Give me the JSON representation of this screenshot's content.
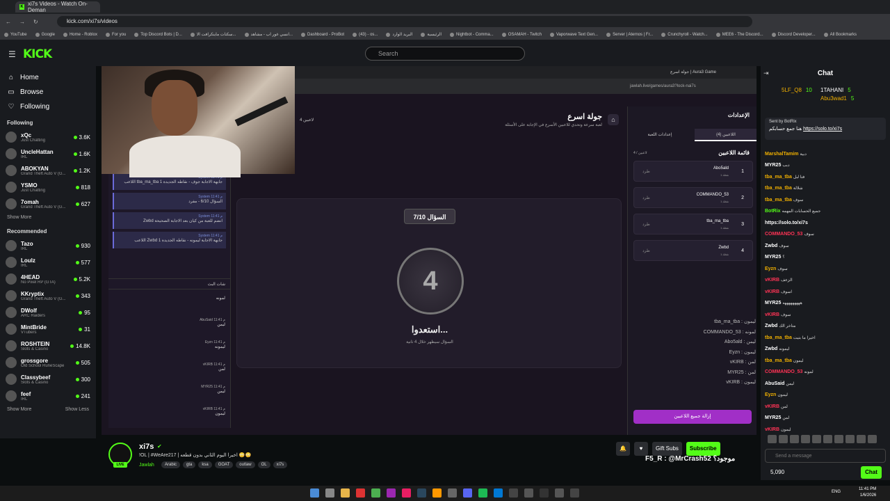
{
  "browser": {
    "tab_title": "xi7s Videos - Watch On-Deman",
    "url": "kick.com/xi7s/videos",
    "bookmarks": [
      "YouTube",
      "Google",
      "Home - Roblox",
      "For you",
      "Top Discord Bots | D...",
      "سكنات ماينكرافت الا...",
      "انسي غور اب - مشاهد...",
      "Dashboard - ProBot",
      "(43) - os...",
      "البريد الوارد",
      "الرئيسية",
      "Nightbot - Comma...",
      "OSAMAH - Twitch",
      "Vaporwave Text Gen...",
      "Server | Aternos | Fr...",
      "Crunchyroll - Watch...",
      "MEE6 - The Discord...",
      "Discord Developer...",
      "All Bookmarks"
    ]
  },
  "nav": {
    "logo": "KICK",
    "search_placeholder": "Search"
  },
  "sidebar": {
    "main": [
      {
        "label": "Home",
        "icon": "home-icon"
      },
      {
        "label": "Browse",
        "icon": "browse-icon"
      },
      {
        "label": "Following",
        "icon": "heart-icon"
      }
    ],
    "following_title": "Following",
    "following": [
      {
        "name": "xQc",
        "cat": "Just Chatting",
        "viewers": "3.6K"
      },
      {
        "name": "UncleHattan",
        "cat": "IRL",
        "viewers": "1.6K"
      },
      {
        "name": "ABOKYAN",
        "cat": "Grand Theft Auto V (G...",
        "viewers": "1.2K"
      },
      {
        "name": "YSMO",
        "cat": "Just Chatting",
        "viewers": "818"
      },
      {
        "name": "7omah",
        "cat": "Grand Theft Auto V (G...",
        "viewers": "627"
      }
    ],
    "show_more": "Show More",
    "recommended_title": "Recommended",
    "recommended": [
      {
        "name": "Tazo",
        "cat": "IRL",
        "viewers": "930"
      },
      {
        "name": "Loulz",
        "cat": "IRL",
        "viewers": "577"
      },
      {
        "name": "4HEAD",
        "cat": "No Pixel RP (GTA)",
        "viewers": "5.2K"
      },
      {
        "name": "KKryptix",
        "cat": "Grand Theft Auto V (G...",
        "viewers": "343"
      },
      {
        "name": "DWolf",
        "cat": "ARC Raiders",
        "viewers": "95"
      },
      {
        "name": "MintBride",
        "cat": "VTubers",
        "viewers": "31"
      },
      {
        "name": "ROSHTEIN",
        "cat": "Slots & Casino",
        "viewers": "14.8K"
      },
      {
        "name": "grossgore",
        "cat": "Old School RuneScape",
        "viewers": "505"
      },
      {
        "name": "Classybeef",
        "cat": "Slots & Casino",
        "viewers": "300"
      },
      {
        "name": "feef",
        "cat": "IRL",
        "viewers": "241"
      }
    ],
    "show_more2": "Show More",
    "show_less": "Show Less"
  },
  "game": {
    "inner_tab": "جولة اسرع | Aura3 Game",
    "inner_url": "jawlah.live/games/aura3?lock-nai7s",
    "title": "جولة اسرع",
    "subtitle": "لعبة سرعة وتحدي للاعبين الأسرع في الإجابة على الأسئلة",
    "player_count": "4 لاعبين",
    "system_msgs": [
      {
        "meta": "System 11:41 م",
        "text": "اللاعب tba_ma_tba جابهة الاجابة جوف - نقاطه الجديدة 1"
      },
      {
        "meta": "System 11:41 م",
        "text": "السؤال 6/10 - مفرد"
      },
      {
        "meta": "System 11:41 م",
        "text": "Zwbd انضم للعبة من كيان بعد الاجابة الصحيحة"
      },
      {
        "meta": "System 11:41 م",
        "text": "اللاعب Zwbd جابهة الاجابة ليمونه - نقاطه الجديدة 1"
      }
    ],
    "chat_header": "شات البث",
    "chat_msgs": [
      {
        "who": "",
        "text": "لمونه"
      },
      {
        "who": "AbuSaid 11:41 م",
        "text": "ليمن"
      },
      {
        "who": "Eyzn 11:41 م",
        "text": "ليمونه"
      },
      {
        "who": "vKIRB 11:41 م",
        "text": "لمن"
      },
      {
        "who": "MYR25 11:41 م",
        "text": "ليمن"
      },
      {
        "who": "vKIRB 11:41 م",
        "text": "ليمون"
      }
    ],
    "question_label": "السؤال 7/10",
    "countdown": "4",
    "get_ready": "استعدوا...",
    "get_ready_sub": "السؤال سيظهر خلال 4 ثانية",
    "settings_title": "الإعدادات",
    "tab_players": "اللاعبين (4)",
    "tab_settings": "إعدادات اللعبة",
    "players_title": "قائمة اللاعبين",
    "players_sub": "4 / لاعبين",
    "players": [
      {
        "name": "Abo5ald",
        "rank": "1",
        "sub": "نقطة 1",
        "kick": "طرد"
      },
      {
        "name": "COMMANDO_53",
        "rank": "2",
        "sub": "نقطة 1",
        "kick": "طرد"
      },
      {
        "name": "tba_ma_tba",
        "rank": "3",
        "sub": "نقطة 1",
        "kick": "طرد"
      },
      {
        "name": "Zwbd",
        "rank": "4",
        "sub": "نقطة 1",
        "kick": "طرد"
      }
    ],
    "votes": [
      "tba_ma_tba : ليمون",
      "COMMANDO_53 : لمونه",
      "Abo5ald : ليمن",
      "Eyzn : ليمون",
      "vKIRB : لمن",
      "MYR25 : لمن",
      "vKIRB : ليمون"
    ],
    "remove_all": "إزالة جميع اللاعبين"
  },
  "chat": {
    "title": "Chat",
    "gifters": [
      {
        "name": "5LF_Q8",
        "count": "10"
      },
      {
        "name": "1TAHANI",
        "count": "5"
      },
      {
        "name": "Abu3wad1",
        "count": "5"
      }
    ],
    "pinned_by": "Sent by BotRix",
    "pinned_msg": "هنا جمع حسابكم",
    "pinned_link": "https://solo.to/xi7s",
    "messages": [
      {
        "u": "MarshalTamim",
        "c": "#f0b000",
        "t": "دبية"
      },
      {
        "u": "MYR25",
        "c": "#ffffff",
        "t": "دبب"
      },
      {
        "u": "tba_ma_tba",
        "c": "#f0b000",
        "t": "فتا لبل"
      },
      {
        "u": "tba_ma_tba",
        "c": "#f0b000",
        "t": "شلالة"
      },
      {
        "u": "tba_ma_tba",
        "c": "#f0b000",
        "t": "سوف"
      },
      {
        "u": "BotRix",
        "c": "#53fc18",
        "t": "جميع الحسابات المهمه"
      },
      {
        "u": "https://solo.to/xi7s",
        "c": "#ffffff",
        "t": ""
      },
      {
        "u": "COMMANDO_53",
        "c": "#ff3355",
        "t": "سوف"
      },
      {
        "u": "Zwbd",
        "c": "#ffffff",
        "t": "سوف"
      },
      {
        "u": "MYR25",
        "c": "#ffffff",
        "t": "؟"
      },
      {
        "u": "Eyzn",
        "c": "#f0b000",
        "t": "سوف"
      },
      {
        "u": "vKIRB",
        "c": "#ff3355",
        "t": "الزعف"
      },
      {
        "u": "vKIRB",
        "c": "#ff3355",
        "t": "اسوف"
      },
      {
        "u": "MYR25",
        "c": "#ffffff",
        "t": "هههههههههه"
      },
      {
        "u": "vKIRB",
        "c": "#ff3355",
        "t": "سوف"
      },
      {
        "u": "Zwbd",
        "c": "#ffffff",
        "t": "متاخر الك"
      },
      {
        "u": "tba_ma_tba",
        "c": "#f0b000",
        "t": "اخيرا ما بتيت"
      },
      {
        "u": "Zwbd",
        "c": "#ffffff",
        "t": "ليمونه"
      },
      {
        "u": "tba_ma_tba",
        "c": "#f0b000",
        "t": "ليمون"
      },
      {
        "u": "COMMANDO_53",
        "c": "#ff3355",
        "t": "لمونه"
      },
      {
        "u": "AbuSaid",
        "c": "#ffffff",
        "t": "ليمن"
      },
      {
        "u": "Eyzn",
        "c": "#f0b000",
        "t": "ليمون"
      },
      {
        "u": "vKIRB",
        "c": "#ff3355",
        "t": "لمن"
      },
      {
        "u": "MYR25",
        "c": "#ffffff",
        "t": "لمن"
      },
      {
        "u": "vKIRB",
        "c": "#ff3355",
        "t": "ليمون"
      }
    ],
    "input_placeholder": "Send a message",
    "points": "5,090",
    "send_label": "Chat"
  },
  "stream": {
    "name": "xi7s",
    "live": "LIVE",
    "title": "!OL | #WeAre217 | اخيرا اليوم الثاني بدون قطعه 😳😳",
    "category": "Jawlah",
    "tags": [
      "Arabic",
      "gta",
      "ksa",
      "GOAT",
      "outlaw",
      "OL",
      "xi7s"
    ],
    "gift_subs": "Gift Subs",
    "subscribe": "Subscribe",
    "overlay": "F5_R : @MrCrash52 موجود؟"
  },
  "taskbar": {
    "lang": "ENG",
    "time": "11:41 PM",
    "date": "1/6/2026"
  },
  "colors": {
    "accent": "#53fc18",
    "purple": "#a12fc7"
  }
}
